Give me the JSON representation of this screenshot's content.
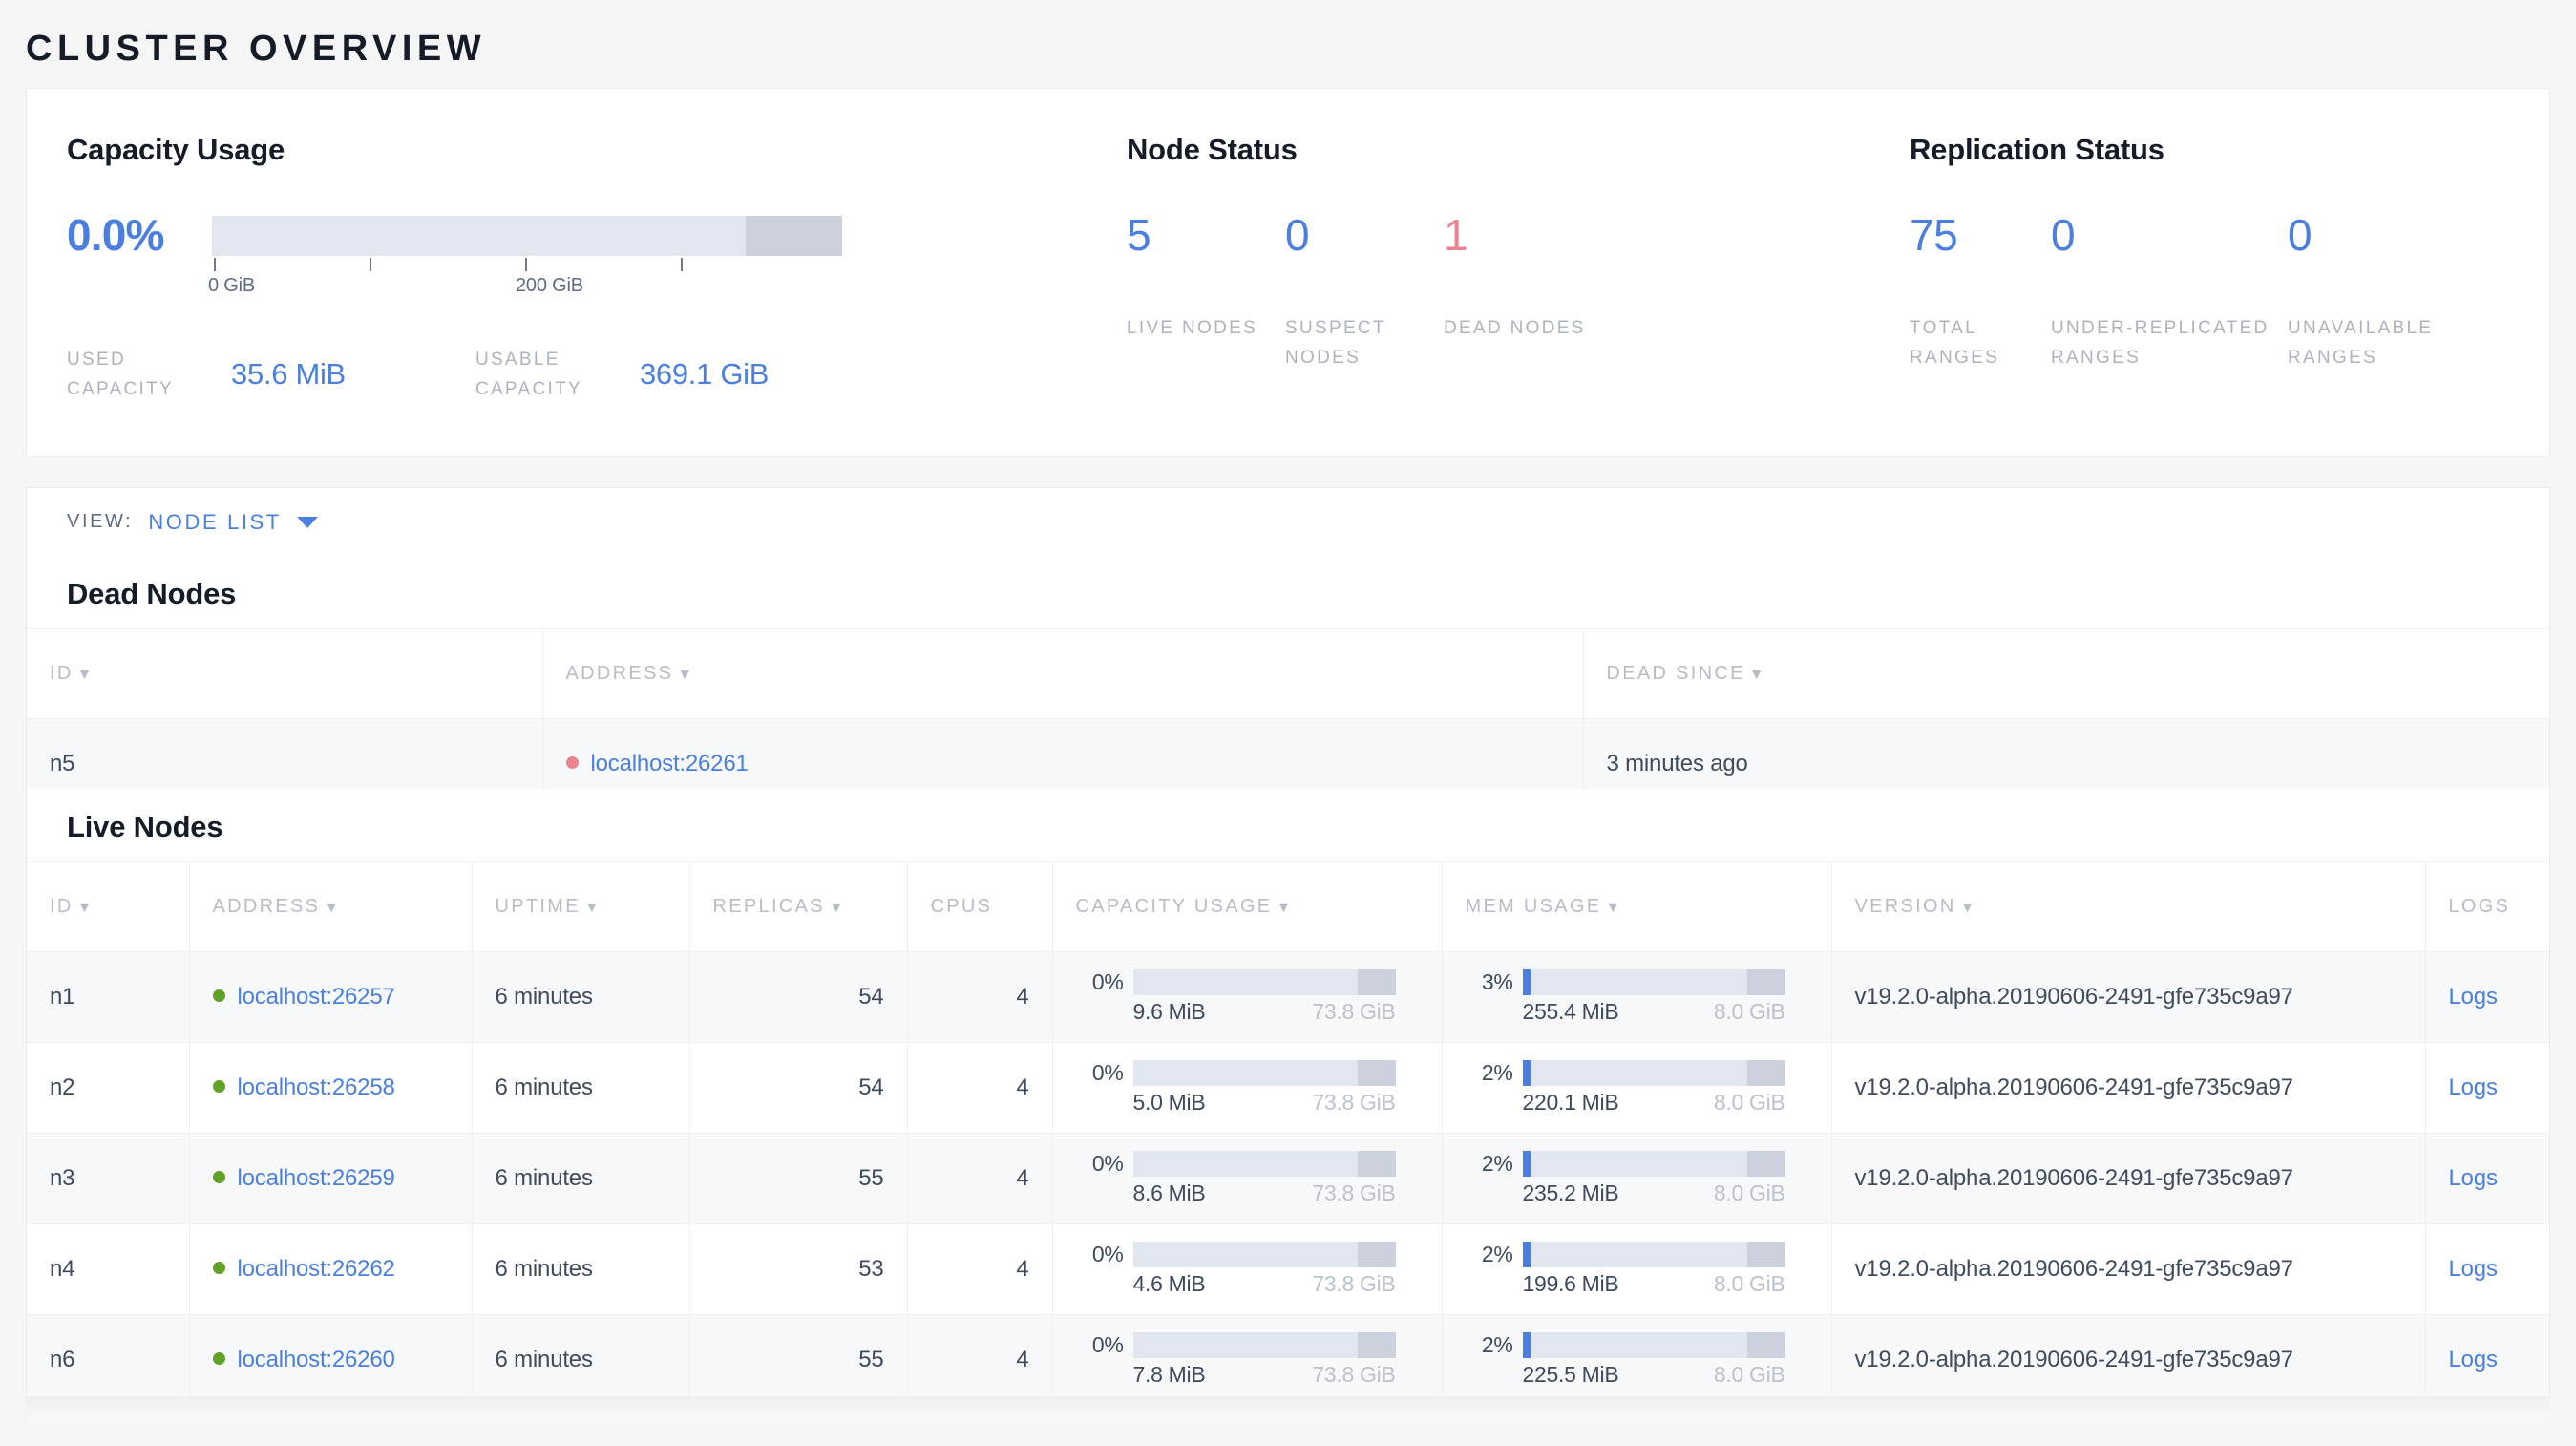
{
  "page": {
    "title": "CLUSTER OVERVIEW"
  },
  "summary": {
    "capacity": {
      "title": "Capacity Usage",
      "percent": "0.0%",
      "percent_value": 0.0,
      "axis": {
        "labels": [
          "0 GiB",
          "200 GiB"
        ],
        "tick_count": 4
      },
      "used_label": "USED CAPACITY",
      "used_value": "35.6 MiB",
      "usable_label": "USABLE CAPACITY",
      "usable_value": "369.1 GiB"
    },
    "node_status": {
      "title": "Node Status",
      "items": [
        {
          "value": "5",
          "label": "LIVE NODES",
          "color": "blue"
        },
        {
          "value": "0",
          "label": "SUSPECT NODES",
          "color": "blue"
        },
        {
          "value": "1",
          "label": "DEAD NODES",
          "color": "red"
        }
      ]
    },
    "replication_status": {
      "title": "Replication Status",
      "items": [
        {
          "value": "75",
          "label": "TOTAL RANGES",
          "color": "blue"
        },
        {
          "value": "0",
          "label": "UNDER-REPLICATED RANGES",
          "color": "blue"
        },
        {
          "value": "0",
          "label": "UNAVAILABLE RANGES",
          "color": "blue"
        }
      ]
    }
  },
  "view_selector": {
    "label": "VIEW:",
    "value": "NODE LIST",
    "caret": "chevron-down-icon"
  },
  "dead_nodes": {
    "title": "Dead Nodes",
    "columns": [
      "ID",
      "ADDRESS",
      "DEAD SINCE"
    ],
    "rows": [
      {
        "id": "n5",
        "address": "localhost:26261",
        "dead_since": "3 minutes ago"
      }
    ]
  },
  "live_nodes": {
    "title": "Live Nodes",
    "columns": [
      "ID",
      "ADDRESS",
      "UPTIME",
      "REPLICAS",
      "CPUS",
      "CAPACITY USAGE",
      "MEM USAGE",
      "VERSION",
      "LOGS"
    ],
    "logs_link_label": "Logs",
    "rows": [
      {
        "id": "n1",
        "address": "localhost:26257",
        "uptime": "6 minutes",
        "replicas": "54",
        "cpus": "4",
        "capacity": {
          "pct": "0%",
          "pct_value": 0,
          "used": "9.6 MiB",
          "total": "73.8 GiB"
        },
        "mem": {
          "pct": "3%",
          "pct_value": 3,
          "used": "255.4 MiB",
          "total": "8.0 GiB"
        },
        "version": "v19.2.0-alpha.20190606-2491-gfe735c9a97"
      },
      {
        "id": "n2",
        "address": "localhost:26258",
        "uptime": "6 minutes",
        "replicas": "54",
        "cpus": "4",
        "capacity": {
          "pct": "0%",
          "pct_value": 0,
          "used": "5.0 MiB",
          "total": "73.8 GiB"
        },
        "mem": {
          "pct": "2%",
          "pct_value": 2,
          "used": "220.1 MiB",
          "total": "8.0 GiB"
        },
        "version": "v19.2.0-alpha.20190606-2491-gfe735c9a97"
      },
      {
        "id": "n3",
        "address": "localhost:26259",
        "uptime": "6 minutes",
        "replicas": "55",
        "cpus": "4",
        "capacity": {
          "pct": "0%",
          "pct_value": 0,
          "used": "8.6 MiB",
          "total": "73.8 GiB"
        },
        "mem": {
          "pct": "2%",
          "pct_value": 2,
          "used": "235.2 MiB",
          "total": "8.0 GiB"
        },
        "version": "v19.2.0-alpha.20190606-2491-gfe735c9a97"
      },
      {
        "id": "n4",
        "address": "localhost:26262",
        "uptime": "6 minutes",
        "replicas": "53",
        "cpus": "4",
        "capacity": {
          "pct": "0%",
          "pct_value": 0,
          "used": "4.6 MiB",
          "total": "73.8 GiB"
        },
        "mem": {
          "pct": "2%",
          "pct_value": 2,
          "used": "199.6 MiB",
          "total": "8.0 GiB"
        },
        "version": "v19.2.0-alpha.20190606-2491-gfe735c9a97"
      },
      {
        "id": "n6",
        "address": "localhost:26260",
        "uptime": "6 minutes",
        "replicas": "55",
        "cpus": "4",
        "capacity": {
          "pct": "0%",
          "pct_value": 0,
          "used": "7.8 MiB",
          "total": "73.8 GiB"
        },
        "mem": {
          "pct": "2%",
          "pct_value": 2,
          "used": "225.5 MiB",
          "total": "8.0 GiB"
        },
        "version": "v19.2.0-alpha.20190606-2491-gfe735c9a97"
      }
    ]
  },
  "colors": {
    "accent_blue": "#4a7fe0",
    "danger_red": "#e8838f",
    "live_green": "#5fa224",
    "track": "#e2e6ef",
    "reserved": "#ccd1dd"
  }
}
